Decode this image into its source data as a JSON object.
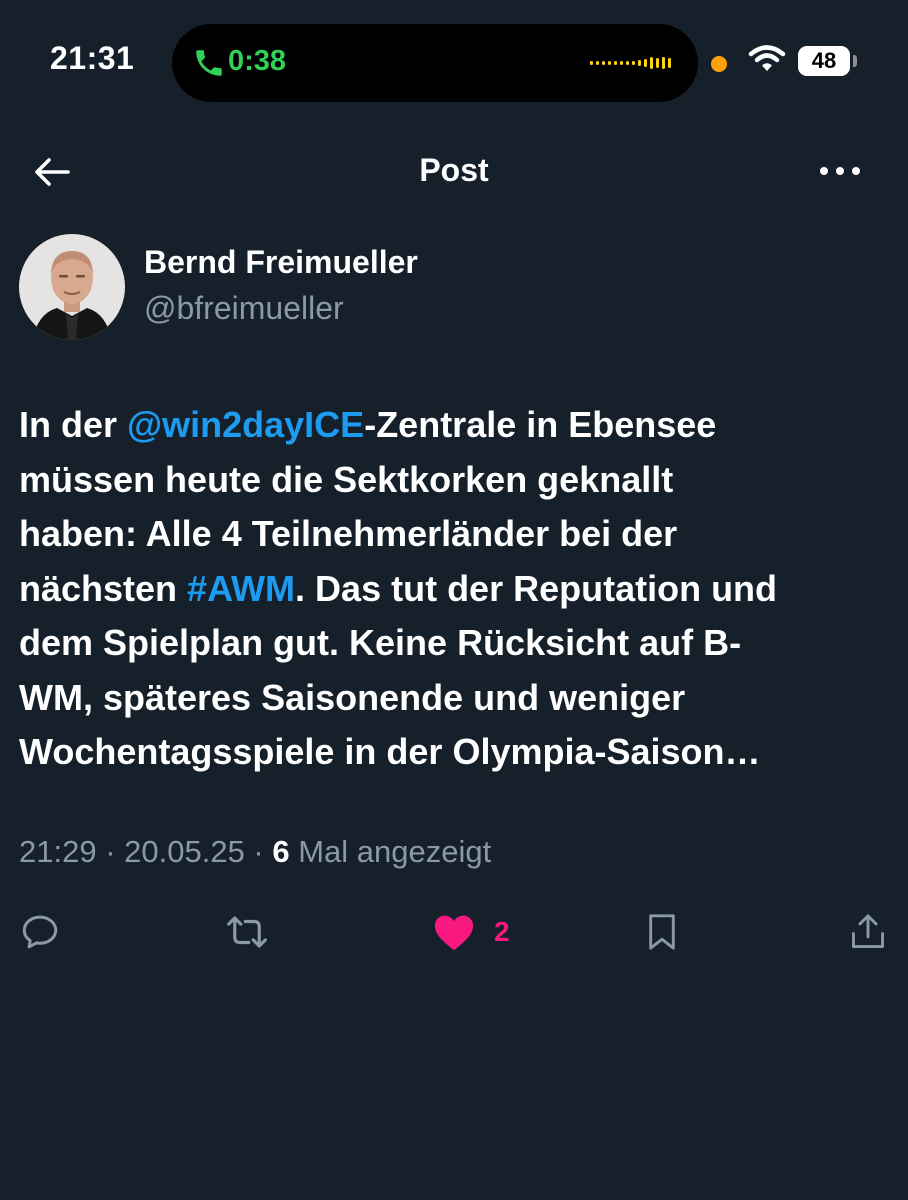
{
  "status_bar": {
    "time": "21:31",
    "call_duration": "0:38",
    "battery_level": "48",
    "icons": [
      "phone-icon",
      "waveform-icon",
      "recording-indicator",
      "wifi-icon",
      "battery-icon"
    ],
    "call_color": "#30d158"
  },
  "header": {
    "title": "Post",
    "back_icon": "arrow-left-icon",
    "more_icon": "ellipsis-icon"
  },
  "author": {
    "name": "Bernd Freimueller",
    "handle": "@bfreimueller"
  },
  "tweet": {
    "lines": [
      [
        "In der ",
        "@win2dayICE",
        "-Zentrale in Ebensee"
      ],
      [
        "müssen heute die Sektkorken geknallt"
      ],
      [
        "haben: Alle 4 Teilnehmerländer bei der"
      ],
      [
        "nächsten ",
        "#AWM",
        ". Das tut der Reputation und"
      ],
      [
        "dem Spielplan gut. Keine Rücksicht auf B-"
      ],
      [
        "WM, späteres Saisonende und weniger"
      ],
      [
        "Wochentagsspiele in der Olympia-Saison…"
      ]
    ],
    "link_color": "#1d9bf0"
  },
  "meta": {
    "time": "21:29",
    "separator": " · ",
    "date": "20.05.25",
    "views_count": "6",
    "views_label": " Mal angezeigt"
  },
  "actions": {
    "reply_icon": "reply-icon",
    "repost_icon": "repost-icon",
    "like_icon": "heart-filled-icon",
    "like_count": "2",
    "like_color": "#f91880",
    "bookmark_icon": "bookmark-icon",
    "share_icon": "share-icon"
  },
  "colors": {
    "background": "#15202b",
    "text_primary": "#ffffff",
    "text_secondary": "#8b98a5"
  }
}
